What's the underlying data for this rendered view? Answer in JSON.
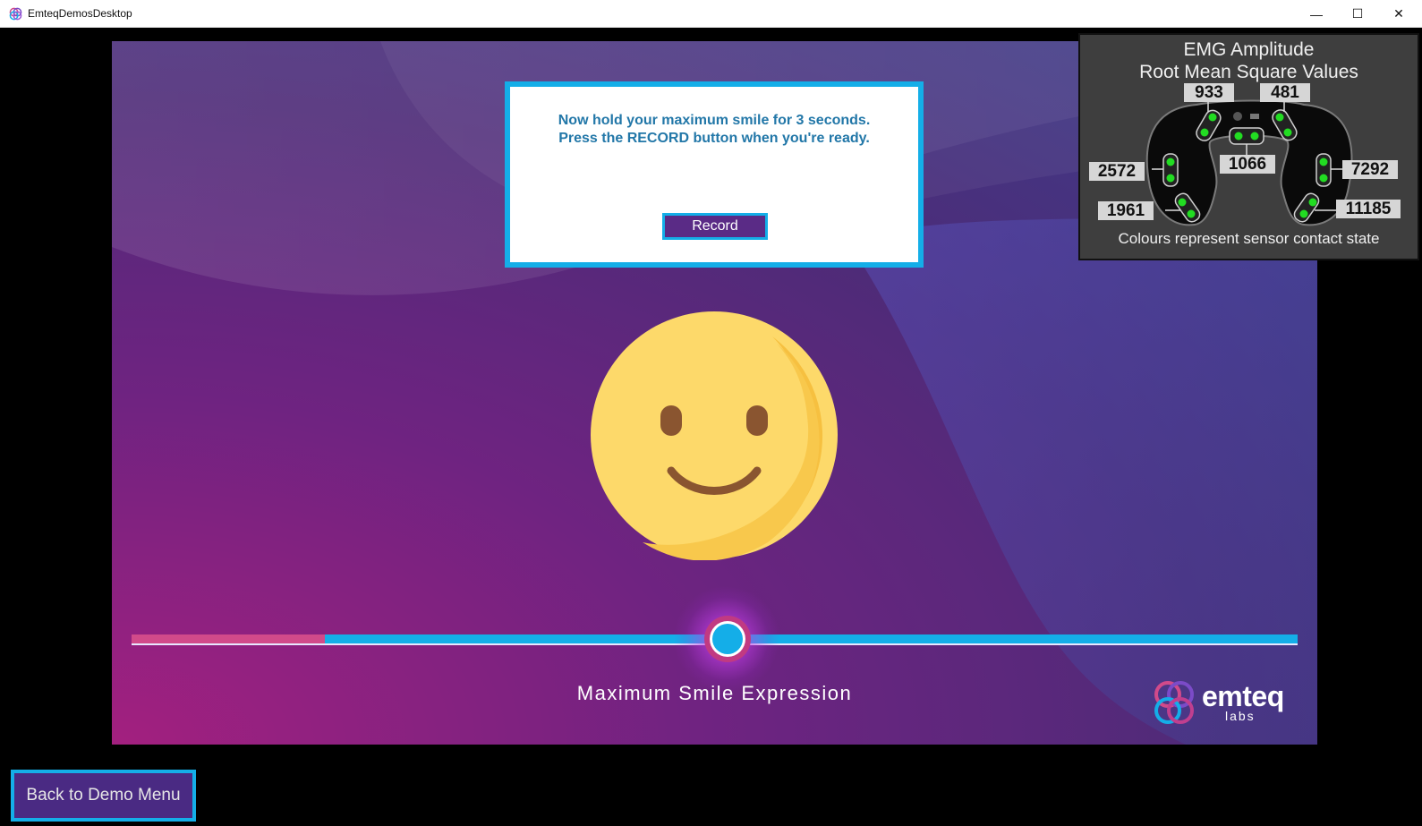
{
  "window": {
    "title": "EmteqDemosDesktop",
    "controls": {
      "minimize": "—",
      "maximize": "☐",
      "close": "✕"
    }
  },
  "dialog": {
    "line1": "Now hold your maximum smile for 3 seconds.",
    "line2": "Press the RECORD button when you're ready.",
    "record_label": "Record"
  },
  "expression": {
    "label": "Maximum Smile Expression",
    "slider_progress": 0.166,
    "thumb_position": 0.5
  },
  "logo": {
    "word": "emteq",
    "sub": "labs"
  },
  "emg_panel": {
    "title_line1": "EMG Amplitude",
    "title_line2": "Root Mean Square Values",
    "caption": "Colours represent sensor contact state",
    "values": {
      "top_left": "933",
      "top_right": "481",
      "center": "1066",
      "left_mid": "2572",
      "right_mid": "7292",
      "left_low": "1961",
      "right_low": "11185"
    },
    "sensor_color": "#22dd22"
  },
  "back_button": {
    "label": "Back to Demo Menu"
  },
  "colors": {
    "accent_blue": "#14aee8",
    "button_purple": "#5a2b86",
    "dialog_text": "#2277a8",
    "slider_pink": "#d14a8a",
    "smiley_yellow": "#fdd96a"
  }
}
